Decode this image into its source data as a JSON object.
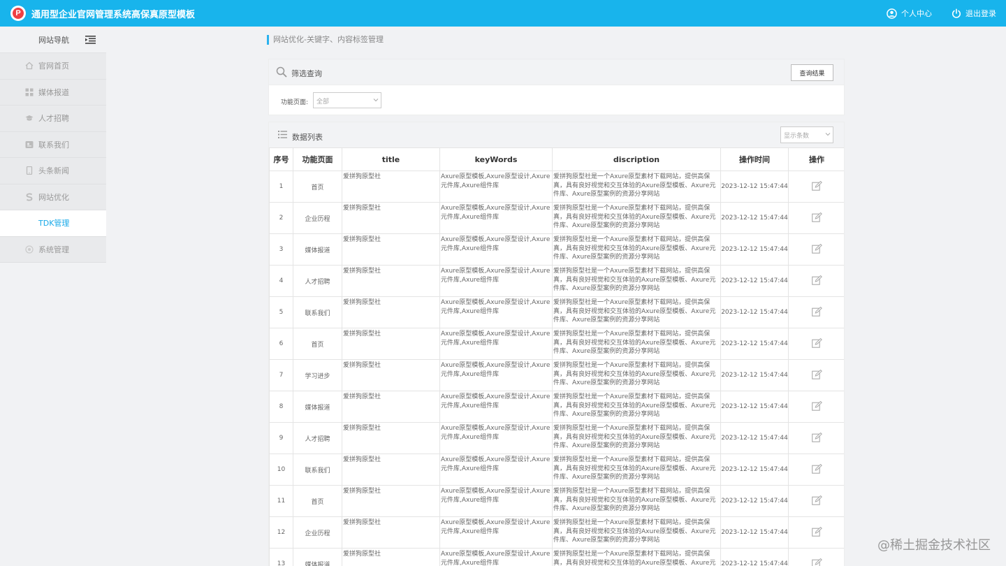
{
  "app": {
    "logo_letter": "P",
    "title": "通用型企业官网管理系统高保真原型模板"
  },
  "top_actions": {
    "profile": "个人中心",
    "logout": "退出登录"
  },
  "sidebar": {
    "header": "网站导航",
    "items": [
      {
        "label": "官网首页",
        "icon": "home-icon"
      },
      {
        "label": "媒体报道",
        "icon": "grid-icon"
      },
      {
        "label": "人才招聘",
        "icon": "graduation-cap-icon"
      },
      {
        "label": "联系我们",
        "icon": "contact-card-icon"
      },
      {
        "label": "头条新闻",
        "icon": "phone-icon"
      },
      {
        "label": "网站优化",
        "icon": "seo-icon"
      }
    ],
    "sub_item": "TDK管理",
    "system": {
      "label": "系统管理",
      "icon": "settings-icon"
    }
  },
  "breadcrumb": "网站优化-关键字、内容标签管理",
  "filter": {
    "title": "筛选查询",
    "query_button": "查询结果",
    "label": "功能页面:",
    "select_value": "全部"
  },
  "list": {
    "title": "数据列表",
    "page_size_placeholder": "显示条数",
    "columns": [
      "序号",
      "功能页面",
      "title",
      "keyWords",
      "discription",
      "操作时间",
      "操作"
    ],
    "rows": [
      {
        "no": "1",
        "page": "首页",
        "title": "爱拼狗原型社",
        "keywords": "Axure原型模板,Axure原型设计,Axure元件库,Axure组件库",
        "description": "爱拼狗原型社是一个Axure原型素材下载网站，提供高保真，具有良好视觉和交互体验的Axure原型模板、Axure元件库、Axure原型案例的资源分享网站",
        "time": "2023-12-12 15:47:44"
      },
      {
        "no": "2",
        "page": "企业历程",
        "title": "爱拼狗原型社",
        "keywords": "Axure原型模板,Axure原型设计,Axure元件库,Axure组件库",
        "description": "爱拼狗原型社是一个Axure原型素材下载网站，提供高保真，具有良好视觉和交互体验的Axure原型模板、Axure元件库、Axure原型案例的资源分享网站",
        "time": "2023-12-12 15:47:44"
      },
      {
        "no": "3",
        "page": "媒体报道",
        "title": "爱拼狗原型社",
        "keywords": "Axure原型模板,Axure原型设计,Axure元件库,Axure组件库",
        "description": "爱拼狗原型社是一个Axure原型素材下载网站，提供高保真，具有良好视觉和交互体验的Axure原型模板、Axure元件库、Axure原型案例的资源分享网站",
        "time": "2023-12-12 15:47:44"
      },
      {
        "no": "4",
        "page": "人才招聘",
        "title": "爱拼狗原型社",
        "keywords": "Axure原型模板,Axure原型设计,Axure元件库,Axure组件库",
        "description": "爱拼狗原型社是一个Axure原型素材下载网站，提供高保真，具有良好视觉和交互体验的Axure原型模板、Axure元件库、Axure原型案例的资源分享网站",
        "time": "2023-12-12 15:47:44"
      },
      {
        "no": "5",
        "page": "联系我们",
        "title": "爱拼狗原型社",
        "keywords": "Axure原型模板,Axure原型设计,Axure元件库,Axure组件库",
        "description": "爱拼狗原型社是一个Axure原型素材下载网站，提供高保真，具有良好视觉和交互体验的Axure原型模板、Axure元件库、Axure原型案例的资源分享网站",
        "time": "2023-12-12 15:47:44"
      },
      {
        "no": "6",
        "page": "首页",
        "title": "爱拼狗原型社",
        "keywords": "Axure原型模板,Axure原型设计,Axure元件库,Axure组件库",
        "description": "爱拼狗原型社是一个Axure原型素材下载网站，提供高保真，具有良好视觉和交互体验的Axure原型模板、Axure元件库、Axure原型案例的资源分享网站",
        "time": "2023-12-12 15:47:44"
      },
      {
        "no": "7",
        "page": "学习进步",
        "title": "爱拼狗原型社",
        "keywords": "Axure原型模板,Axure原型设计,Axure元件库,Axure组件库",
        "description": "爱拼狗原型社是一个Axure原型素材下载网站，提供高保真，具有良好视觉和交互体验的Axure原型模板、Axure元件库、Axure原型案例的资源分享网站",
        "time": "2023-12-12 15:47:44"
      },
      {
        "no": "8",
        "page": "媒体报道",
        "title": "爱拼狗原型社",
        "keywords": "Axure原型模板,Axure原型设计,Axure元件库,Axure组件库",
        "description": "爱拼狗原型社是一个Axure原型素材下载网站，提供高保真，具有良好视觉和交互体验的Axure原型模板、Axure元件库、Axure原型案例的资源分享网站",
        "time": "2023-12-12 15:47:44"
      },
      {
        "no": "9",
        "page": "人才招聘",
        "title": "爱拼狗原型社",
        "keywords": "Axure原型模板,Axure原型设计,Axure元件库,Axure组件库",
        "description": "爱拼狗原型社是一个Axure原型素材下载网站，提供高保真，具有良好视觉和交互体验的Axure原型模板、Axure元件库、Axure原型案例的资源分享网站",
        "time": "2023-12-12 15:47:44"
      },
      {
        "no": "10",
        "page": "联系我们",
        "title": "爱拼狗原型社",
        "keywords": "Axure原型模板,Axure原型设计,Axure元件库,Axure组件库",
        "description": "爱拼狗原型社是一个Axure原型素材下载网站，提供高保真，具有良好视觉和交互体验的Axure原型模板、Axure元件库、Axure原型案例的资源分享网站",
        "time": "2023-12-12 15:47:44"
      },
      {
        "no": "11",
        "page": "首页",
        "title": "爱拼狗原型社",
        "keywords": "Axure原型模板,Axure原型设计,Axure元件库,Axure组件库",
        "description": "爱拼狗原型社是一个Axure原型素材下载网站，提供高保真，具有良好视觉和交互体验的Axure原型模板、Axure元件库、Axure原型案例的资源分享网站",
        "time": "2023-12-12 15:47:44"
      },
      {
        "no": "12",
        "page": "企业历程",
        "title": "爱拼狗原型社",
        "keywords": "Axure原型模板,Axure原型设计,Axure元件库,Axure组件库",
        "description": "爱拼狗原型社是一个Axure原型素材下载网站，提供高保真，具有良好视觉和交互体验的Axure原型模板、Axure元件库、Axure原型案例的资源分享网站",
        "time": "2023-12-12 15:47:44"
      },
      {
        "no": "13",
        "page": "媒体报道",
        "title": "爱拼狗原型社",
        "keywords": "Axure原型模板,Axure原型设计,Axure元件库,Axure组件库",
        "description": "爱拼狗原型社是一个Axure原型素材下载网站，提供高保真，具有良好视觉和交互体验的Axure原型模板、Axure元件库、Axure原型案例的资源分享网站",
        "time": "2023-12-12 15:47:44"
      }
    ]
  },
  "watermark": "@稀土掘金技术社区",
  "colors": {
    "accent": "#18b4ec",
    "active_link": "#18a9e8",
    "logo_red": "#ee4043"
  }
}
